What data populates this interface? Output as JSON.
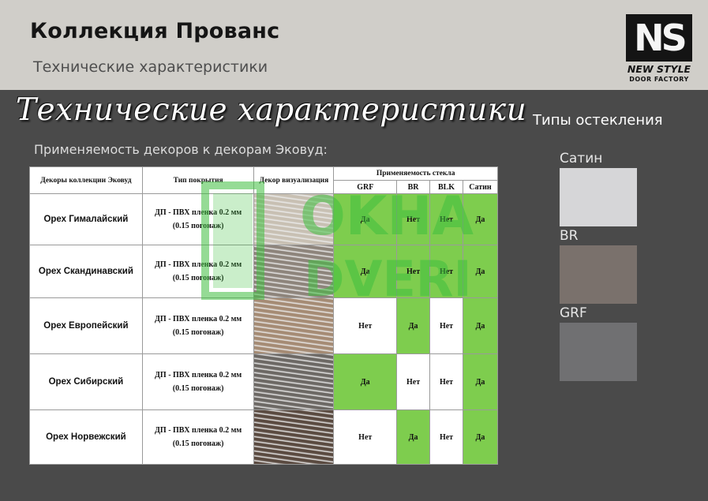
{
  "header": {
    "title": "Коллекция Прованс",
    "subtitle": "Технические характеристики"
  },
  "logo": {
    "mark": "NS",
    "name": "NEW STYLE",
    "subtitle": "DOOR FACTORY"
  },
  "script_title": "Технические характеристики",
  "intro": "Применяемость декоров к декорам Эковуд:",
  "table": {
    "headers": {
      "decor": "Декоры коллекции Эковуд",
      "coating": "Тип покрытия",
      "visual": "Декор визуализация",
      "glass_group": "Применяемость стекла",
      "glass": [
        "GRF",
        "BR",
        "BLK",
        "Сатин"
      ]
    },
    "coating_line1": "ДП - ПВХ пленка 0.2 мм",
    "rows": [
      {
        "name": "Орех Гималайский",
        "coat1": "ДП - ПВХ пленка 0.2 мм",
        "coat2": "(0.15 погонаж)",
        "swatch": "#c8c0b3",
        "values": [
          "Да",
          "Нет",
          "Нет",
          "Да"
        ],
        "green": [
          true,
          true,
          true,
          true
        ]
      },
      {
        "name": "Орех Скандинавский",
        "coat1": "ДП - ПВХ пленка 0.2 мм",
        "coat2": "(0.15 погонаж)",
        "swatch": "#8d847b",
        "values": [
          "Да",
          "Нет",
          "Нет",
          "Да"
        ],
        "green": [
          true,
          true,
          true,
          true
        ]
      },
      {
        "name": "Орех Европейский",
        "coat1": "ДП - ПВХ пленка 0.2 мм",
        "coat2": "(0.15 погонаж)",
        "swatch": "#a58b74",
        "values": [
          "Нет",
          "Да",
          "Нет",
          "Да"
        ],
        "green": [
          false,
          true,
          false,
          true
        ]
      },
      {
        "name": "Орех Сибирский",
        "coat1": "ДП - ПВХ пленка 0.2 мм",
        "coat2": "(0.15 погонаж)",
        "swatch": "#6c6864",
        "values": [
          "Да",
          "Нет",
          "Нет",
          "Да"
        ],
        "green": [
          true,
          false,
          false,
          true
        ]
      },
      {
        "name": "Орех Норвежский",
        "coat1": "ДП - ПВХ пленка 0.2 мм",
        "coat2": "(0.15 погонаж)",
        "swatch": "#5a4a40",
        "values": [
          "Нет",
          "Да",
          "Нет",
          "Да"
        ],
        "green": [
          false,
          true,
          false,
          true
        ]
      }
    ]
  },
  "glass_types": {
    "title": "Типы остекления",
    "items": [
      {
        "label": "Сатин",
        "color": "#d6d6d8"
      },
      {
        "label": "BR",
        "color": "#7a716c"
      },
      {
        "label": "GRF",
        "color": "#707072"
      }
    ]
  },
  "watermark": {
    "line1": "OKHA",
    "line2": "DVERI",
    "color": "#3fbf3f"
  }
}
